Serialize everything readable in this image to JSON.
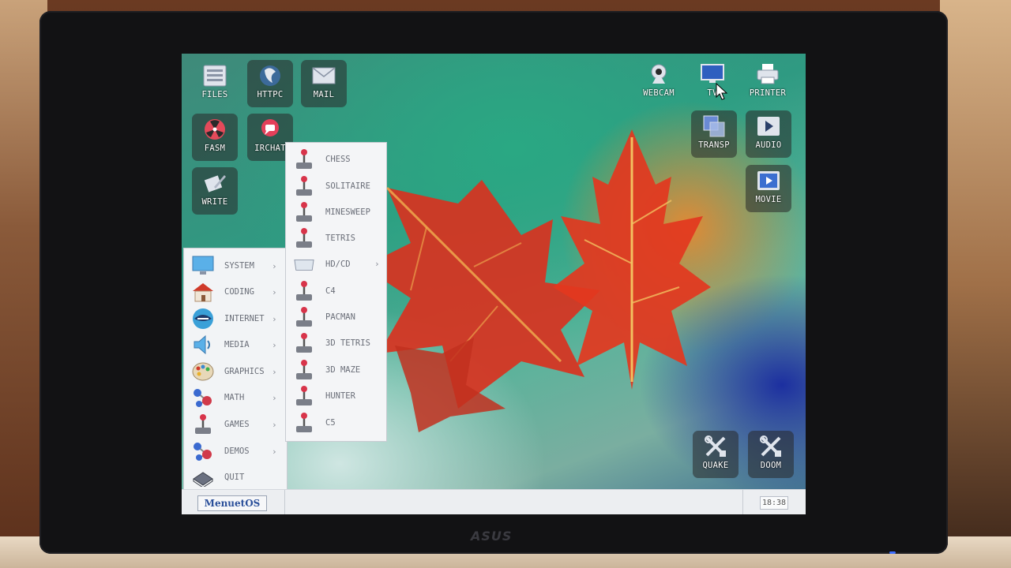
{
  "monitor": {
    "brand": "ASUS"
  },
  "desktop": {
    "icons_left": [
      {
        "label": "FILES",
        "icon": "files-icon"
      },
      {
        "label": "HTTPC",
        "icon": "httpc-icon"
      },
      {
        "label": "MAIL",
        "icon": "mail-icon"
      },
      {
        "label": "FASM",
        "icon": "fasm-icon"
      },
      {
        "label": "IRCHAT",
        "icon": "irchat-icon"
      },
      {
        "label": "WRITE",
        "icon": "write-icon"
      }
    ],
    "icons_right": [
      {
        "label": "WEBCAM",
        "icon": "webcam-icon"
      },
      {
        "label": "TV",
        "icon": "tv-icon"
      },
      {
        "label": "PRINTER",
        "icon": "printer-icon"
      },
      {
        "label": "TRANSP",
        "icon": "transp-icon"
      },
      {
        "label": "AUDIO",
        "icon": "audio-icon"
      },
      {
        "label": "MOVIE",
        "icon": "movie-icon"
      },
      {
        "label": "QUAKE",
        "icon": "quake-icon"
      },
      {
        "label": "DOOM",
        "icon": "doom-icon"
      }
    ]
  },
  "start_menu": {
    "items": [
      {
        "label": "SYSTEM",
        "icon": "monitor-icon",
        "has_submenu": true
      },
      {
        "label": "CODING",
        "icon": "house-icon",
        "has_submenu": true
      },
      {
        "label": "INTERNET",
        "icon": "globe-icon",
        "has_submenu": true
      },
      {
        "label": "MEDIA",
        "icon": "speaker-icon",
        "has_submenu": true
      },
      {
        "label": "GRAPHICS",
        "icon": "palette-icon",
        "has_submenu": true
      },
      {
        "label": "MATH",
        "icon": "molecule-icon",
        "has_submenu": true
      },
      {
        "label": "GAMES",
        "icon": "joystick-icon",
        "has_submenu": true
      },
      {
        "label": "DEMOS",
        "icon": "molecule-icon",
        "has_submenu": true
      },
      {
        "label": "QUIT",
        "icon": "chip-icon",
        "has_submenu": false
      }
    ]
  },
  "games_submenu": {
    "items": [
      {
        "label": "CHESS",
        "icon": "joystick-icon",
        "has_submenu": false
      },
      {
        "label": "SOLITAIRE",
        "icon": "joystick-icon",
        "has_submenu": false
      },
      {
        "label": "MINESWEEP",
        "icon": "joystick-icon",
        "has_submenu": false
      },
      {
        "label": "TETRIS",
        "icon": "joystick-icon",
        "has_submenu": false
      },
      {
        "label": "HD/CD",
        "icon": "drive-icon",
        "has_submenu": true
      },
      {
        "label": "C4",
        "icon": "joystick-icon",
        "has_submenu": false
      },
      {
        "label": "PACMAN",
        "icon": "joystick-icon",
        "has_submenu": false
      },
      {
        "label": "3D TETRIS",
        "icon": "joystick-icon",
        "has_submenu": false
      },
      {
        "label": "3D MAZE",
        "icon": "joystick-icon",
        "has_submenu": false
      },
      {
        "label": "HUNTER",
        "icon": "joystick-icon",
        "has_submenu": false
      },
      {
        "label": "C5",
        "icon": "joystick-icon",
        "has_submenu": false
      }
    ]
  },
  "taskbar": {
    "start_label": "MenuetOS",
    "clock": "18:38"
  },
  "submenu_arrow": "›",
  "colors": {
    "taskbar": "#eceef1",
    "menu_bg": "#f2f4f6",
    "menu_text": "#6a6e78",
    "start_text": "#2a4f9a"
  }
}
